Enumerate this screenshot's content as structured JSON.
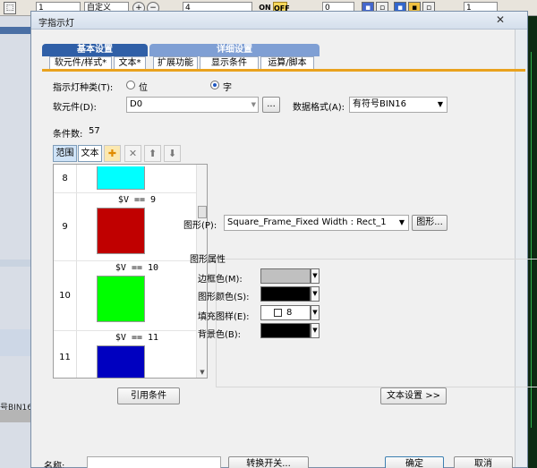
{
  "bg_app": {
    "toolbar_fields": [
      "1",
      "自定义",
      "4",
      "0",
      "1"
    ],
    "on_label": "ON",
    "off_label": "OFF",
    "left_status": "号BIN16",
    "colors": {
      "grid": "#2db34a",
      "ladder_bg": "#0d2a12",
      "left_band": "#4a6fa5"
    }
  },
  "dialog": {
    "title": "字指示灯",
    "close_label": "✕"
  },
  "tabs": {
    "group1_title": "基本设置",
    "group2_title": "详细设置",
    "items": [
      {
        "label": "软元件/样式*"
      },
      {
        "label": "文本*"
      },
      {
        "label": "扩展功能"
      },
      {
        "label": "显示条件"
      },
      {
        "label": "运算/脚本"
      }
    ],
    "accent_color": "#e9a21e",
    "group_color": "#2f5fa7"
  },
  "form": {
    "indicator_type_label": "指示灯种类(T):",
    "option_bit": "位",
    "option_word": "字",
    "selected": "字",
    "device_label": "软元件(D):",
    "device_value": "D0",
    "browse_label": "...",
    "format_label": "数据格式(A):",
    "format_value": "有符号BIN16",
    "condition_count_label": "条件数:",
    "condition_count": "57"
  },
  "list_toolbar": {
    "range_btn": "范围",
    "text_btn": "文本",
    "icons": [
      "add-icon",
      "delete-icon",
      "up-arrow-icon",
      "down-arrow-icon"
    ]
  },
  "conditions": [
    {
      "num": "8",
      "color": "#00ffff",
      "expr": ""
    },
    {
      "num": "9",
      "color": "#c00000",
      "expr": "$V  ==  9"
    },
    {
      "num": "10",
      "color": "#00ff00",
      "expr": "$V  ==  10"
    },
    {
      "num": "11",
      "color": "#0000c0",
      "expr": "$V  ==  11"
    }
  ],
  "shape": {
    "label": "图形(P):",
    "value": "Square_Frame_Fixed Width : Rect_1",
    "button": "图形..."
  },
  "props": {
    "title": "图形属性",
    "frame_color_label": "边框色(M):",
    "shape_color_label": "图形颜色(S):",
    "fill_pattern_label": "填充图样(E):",
    "fill_pattern_value": "8",
    "background_label": "背景色(B):",
    "frame_color": "#c0c0c0",
    "shape_color": "#000000",
    "background_color": "#000000"
  },
  "buttons": {
    "reference_condition": "引用条件",
    "text_settings": "文本设置 >>",
    "switch_toggle": "转换开关...",
    "ok": "确定",
    "cancel": "取消"
  },
  "bottom": {
    "name_label": "名称:"
  }
}
